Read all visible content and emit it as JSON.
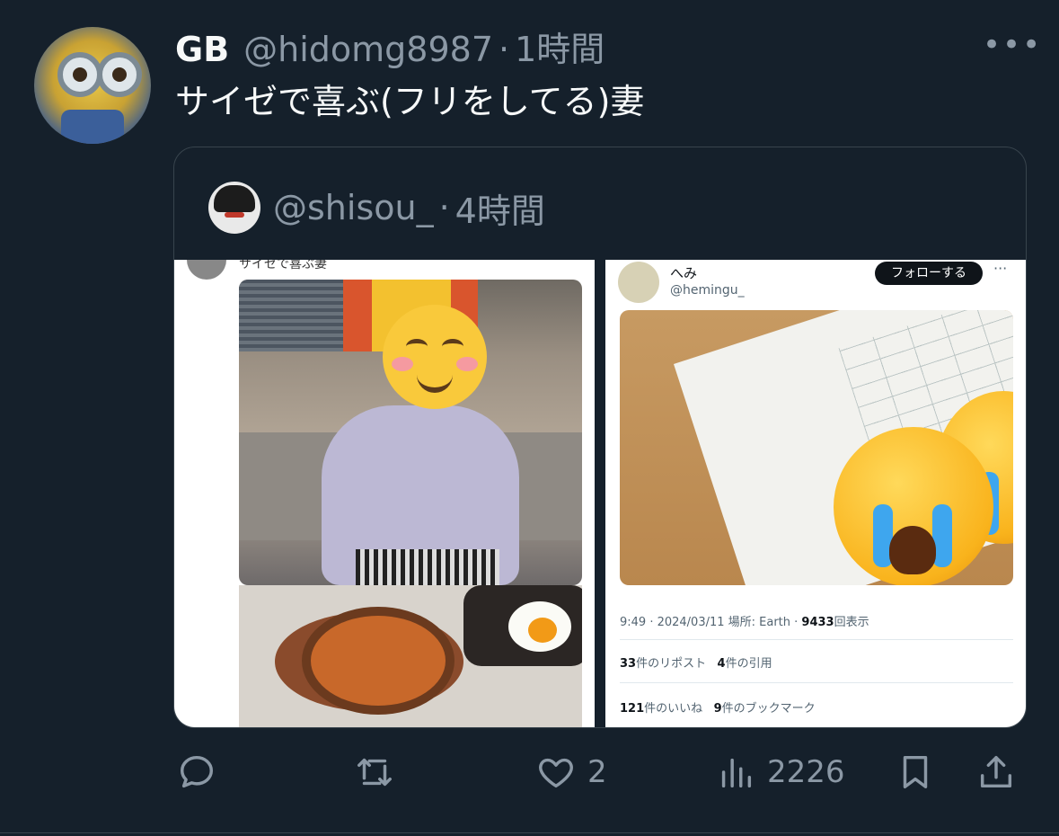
{
  "tweet": {
    "author_name": "GB",
    "author_handle": "@hidomg8987",
    "separator": "·",
    "time": "1時間",
    "text": "サイゼで喜ぶ(フリをしてる)妻",
    "more_icon": "more-horizontal-icon"
  },
  "quote": {
    "handle": "@shisou_",
    "separator": "·",
    "time": "4時間",
    "left_image": {
      "caption_fragment": "サイゼで喜ぶ妻"
    },
    "right_image": {
      "name": "へみ",
      "handle": "@hemingu_",
      "follow_label": "フォローする",
      "more_label": "···",
      "meta_prefix": "9:49 · 2024/03/11 場所: Earth · ",
      "meta_views": "9433",
      "meta_suffix": "回表示",
      "reposts_count": "33",
      "reposts_label": "件のリポスト",
      "quotes_count": "4",
      "quotes_label": "件の引用",
      "likes_count": "121",
      "likes_label": "件のいいね",
      "bookmarks_count": "9",
      "bookmarks_label": "件のブックマーク"
    }
  },
  "actions": {
    "like_count": "2",
    "views_count": "2226"
  },
  "colors": {
    "background": "#15202b",
    "text_primary": "#f7f9f9",
    "text_secondary": "#8b98a5",
    "border": "#38444d"
  }
}
